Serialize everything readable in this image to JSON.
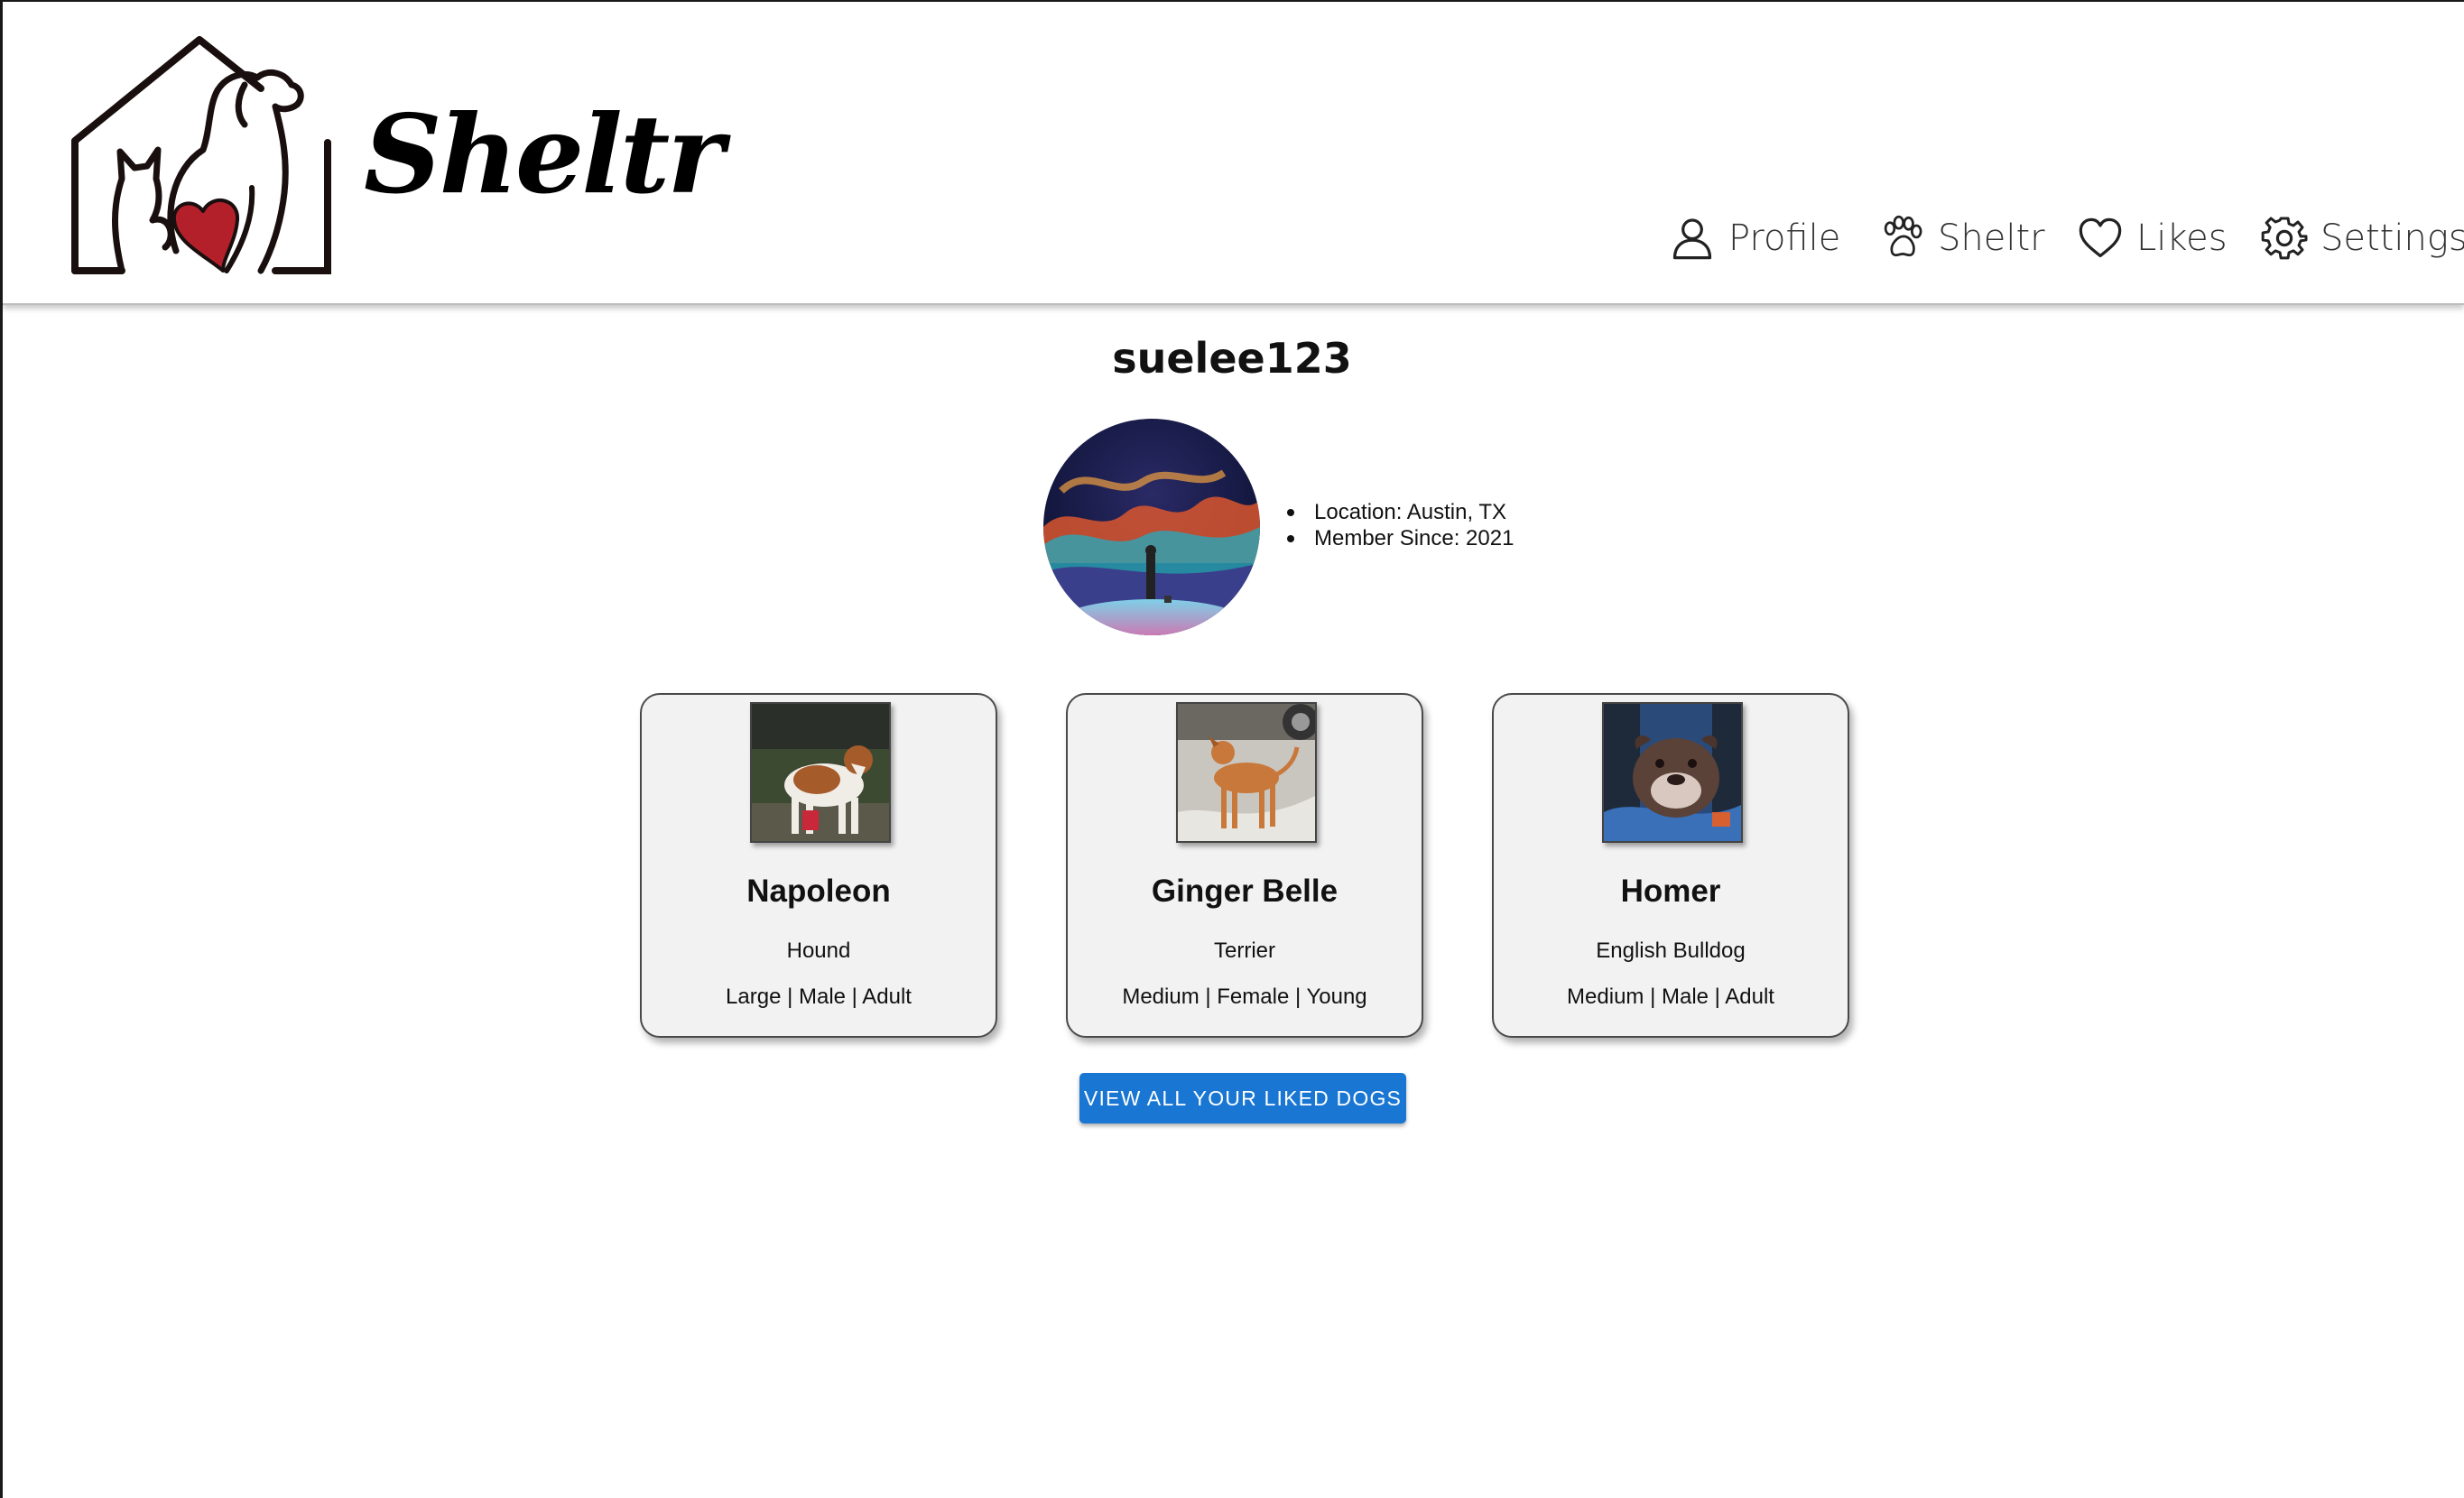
{
  "brand": {
    "name": "Sheltr",
    "heart_color": "#b3202a"
  },
  "nav": [
    {
      "label": "Profile",
      "icon": "person-icon"
    },
    {
      "label": "Sheltr",
      "icon": "paw-icon"
    },
    {
      "label": "Likes",
      "icon": "heart-icon"
    },
    {
      "label": "Settings",
      "icon": "gear-icon"
    }
  ],
  "profile": {
    "username": "suelee123",
    "info": [
      "Location: Austin, TX",
      "Member Since: 2021"
    ]
  },
  "liked_dogs": [
    {
      "name": "Napoleon",
      "breed": "Hound",
      "attributes": "Large | Male | Adult"
    },
    {
      "name": "Ginger Belle",
      "breed": "Terrier",
      "attributes": "Medium | Female | Young"
    },
    {
      "name": "Homer",
      "breed": "English Bulldog",
      "attributes": "Medium | Male | Adult"
    }
  ],
  "cta": {
    "label": "VIEW ALL YOUR LIKED DOGS",
    "color": "#1976d2"
  }
}
